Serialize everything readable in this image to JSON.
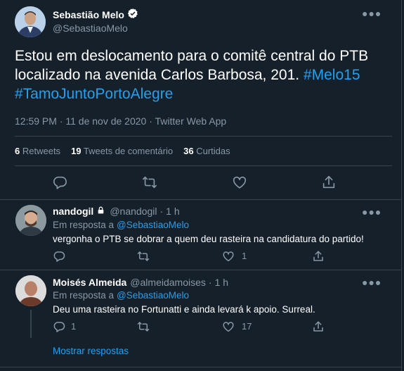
{
  "main_tweet": {
    "author_name": "Sebastião Melo",
    "author_handle": "@SebastiaoMelo",
    "text": "Estou em deslocamento para o comitê central do PTB localizado na avenida Carlos Barbosa, 201.",
    "hashtag1": "#Melo15",
    "hashtag2": "#TamoJuntoPortoAlegre",
    "meta": "12:59 PM · 11 de nov de 2020 · Twitter Web App",
    "stats": {
      "retweets_count": "6",
      "retweets_label": "Retweets",
      "comments_count": "19",
      "comments_label": "Tweets de comentário",
      "likes_count": "36",
      "likes_label": "Curtidas"
    }
  },
  "replies": [
    {
      "name": "nandogil",
      "handle": "@nandogil",
      "sep": "·",
      "time": "1 h",
      "reply_to_prefix": "Em resposta a",
      "reply_to_handle": "@SebastiaoMelo",
      "text": "vergonha o PTB se dobrar a quem deu rasteira na candidatura do partido!",
      "reply_count": "",
      "retweet_count": "",
      "like_count": "1"
    },
    {
      "name": "Moisés Almeida",
      "handle": "@almeidamoises",
      "sep": "·",
      "time": "1 h",
      "reply_to_prefix": "Em resposta a",
      "reply_to_handle": "@SebastiaoMelo",
      "text": "Deu uma rasteira no Fortunatti e ainda levará k apoio. Surreal.",
      "reply_count": "1",
      "retweet_count": "",
      "like_count": "17"
    }
  ],
  "show_replies": "Mostrar respostas",
  "colors": {
    "background": "#15202b",
    "accent": "#1da1f2",
    "muted": "#8899a6",
    "border": "#38444d"
  }
}
